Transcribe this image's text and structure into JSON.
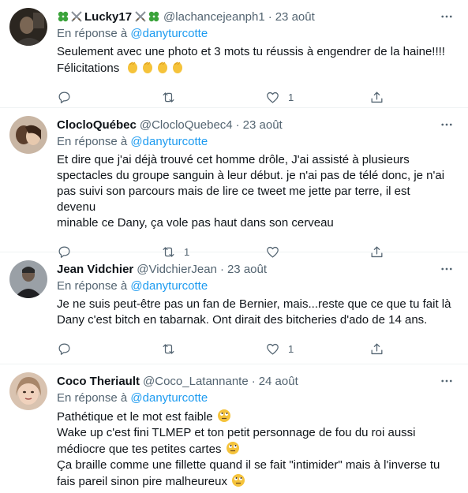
{
  "tweets": [
    {
      "name": "Lucky17",
      "handle": "@lachancejeanph1",
      "separator": "·",
      "time": "23 août",
      "reply_prefix": "En réponse à",
      "reply_to": "@danyturcotte",
      "lines": [
        "Seulement avec une photo et 3 mots tu réussis à engendrer de la haine!!!!",
        "Félicitations"
      ],
      "retweets": "",
      "likes": "1"
    },
    {
      "name": "ClocloQuébec",
      "handle": "@ClocloQuebec4",
      "separator": "·",
      "time": "23 août",
      "reply_prefix": "En réponse à",
      "reply_to": "@danyturcotte",
      "lines": [
        "Et dire que j'ai déjà trouvé cet homme drôle, J'ai assisté à plusieurs",
        "spectacles du groupe sanguin à leur début. je n'ai pas de télé donc, je n'ai",
        "pas suivi son parcours mais de lire ce tweet me jette par terre, il est devenu",
        "minable ce Dany, ça vole pas haut dans son cerveau"
      ],
      "retweets": "1",
      "likes": ""
    },
    {
      "name": "Jean Vidchier",
      "handle": "@VidchierJean",
      "separator": "·",
      "time": "23 août",
      "reply_prefix": "En réponse à",
      "reply_to": "@danyturcotte",
      "lines": [
        "Je ne suis peut-être pas un fan de Bernier, mais...reste que ce que tu fait là",
        "Dany c'est bitch en tabarnak. Ont dirait des bitcheries d'ado de 14 ans."
      ],
      "retweets": "",
      "likes": "1"
    },
    {
      "name": "Coco Theriault",
      "handle": "@Coco_Latannante",
      "separator": "·",
      "time": "24 août",
      "reply_prefix": "En réponse à",
      "reply_to": "@danyturcotte",
      "lines": [
        "Pathétique et le mot est faible",
        "Wake up c'est fini TLMEP et ton petit personnage de fou du roi aussi",
        "médiocre que tes petites cartes",
        "Ça braille comme une fillette quand il se fait \"intimider\" mais à l'inverse tu",
        "fais pareil sinon pire malheureux"
      ],
      "retweets": "",
      "likes": ""
    }
  ],
  "icons": {
    "more": "more-icon",
    "reply": "reply-icon",
    "retweet": "retweet-icon",
    "like": "heart-icon",
    "share": "share-icon",
    "name_decor": [
      "clover-icon",
      "crossed-swords-icon"
    ],
    "clap": "clapping-hands-emoji",
    "face": "rolling-eyes-emoji"
  },
  "colors": {
    "text": "#0f1419",
    "secondary": "#536471",
    "link": "#1d9bf0",
    "divider": "#eff3f4"
  }
}
